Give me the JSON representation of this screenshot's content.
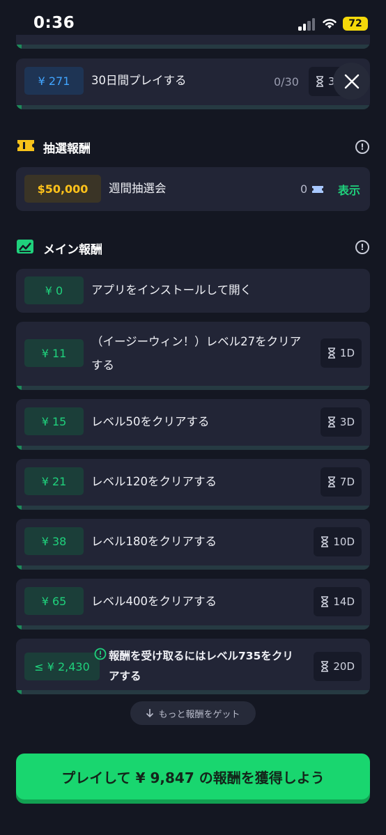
{
  "status": {
    "time": "0:36",
    "battery": "72"
  },
  "prev_task": {
    "reward": "¥ 271",
    "label": "30日間プレイする",
    "progress": "0/30",
    "timer": "3"
  },
  "lottery": {
    "title": "抽選報酬",
    "item": {
      "reward": "$50,000",
      "label": "週間抽選会",
      "count": "0",
      "view": "表示"
    }
  },
  "main": {
    "title": "メイン報酬",
    "tasks": [
      {
        "reward": "¥ 0",
        "label": "アプリをインストールして開く"
      },
      {
        "reward": "¥ 11",
        "label_line1": "（イージーウィン！）レベル27をクリア",
        "label_line2": "する",
        "timer": "1D"
      },
      {
        "reward": "¥ 15",
        "label": "レベル50をクリアする",
        "timer": "3D"
      },
      {
        "reward": "¥ 21",
        "label": "レベル120をクリアする",
        "timer": "7D"
      },
      {
        "reward": "¥ 38",
        "label": "レベル180をクリアする",
        "timer": "10D"
      },
      {
        "reward": "¥ 65",
        "label": "レベル400をクリアする",
        "timer": "14D"
      },
      {
        "reward": "≤ ¥ 2,430",
        "label_line1": "報酬を受け取るにはレベル735をクリ",
        "label_line2": "アする",
        "timer": "20D"
      }
    ]
  },
  "more_button": "もっと報酬をゲット",
  "cta": "プレイして ¥ 9,847 の報酬を獲得しよう"
}
